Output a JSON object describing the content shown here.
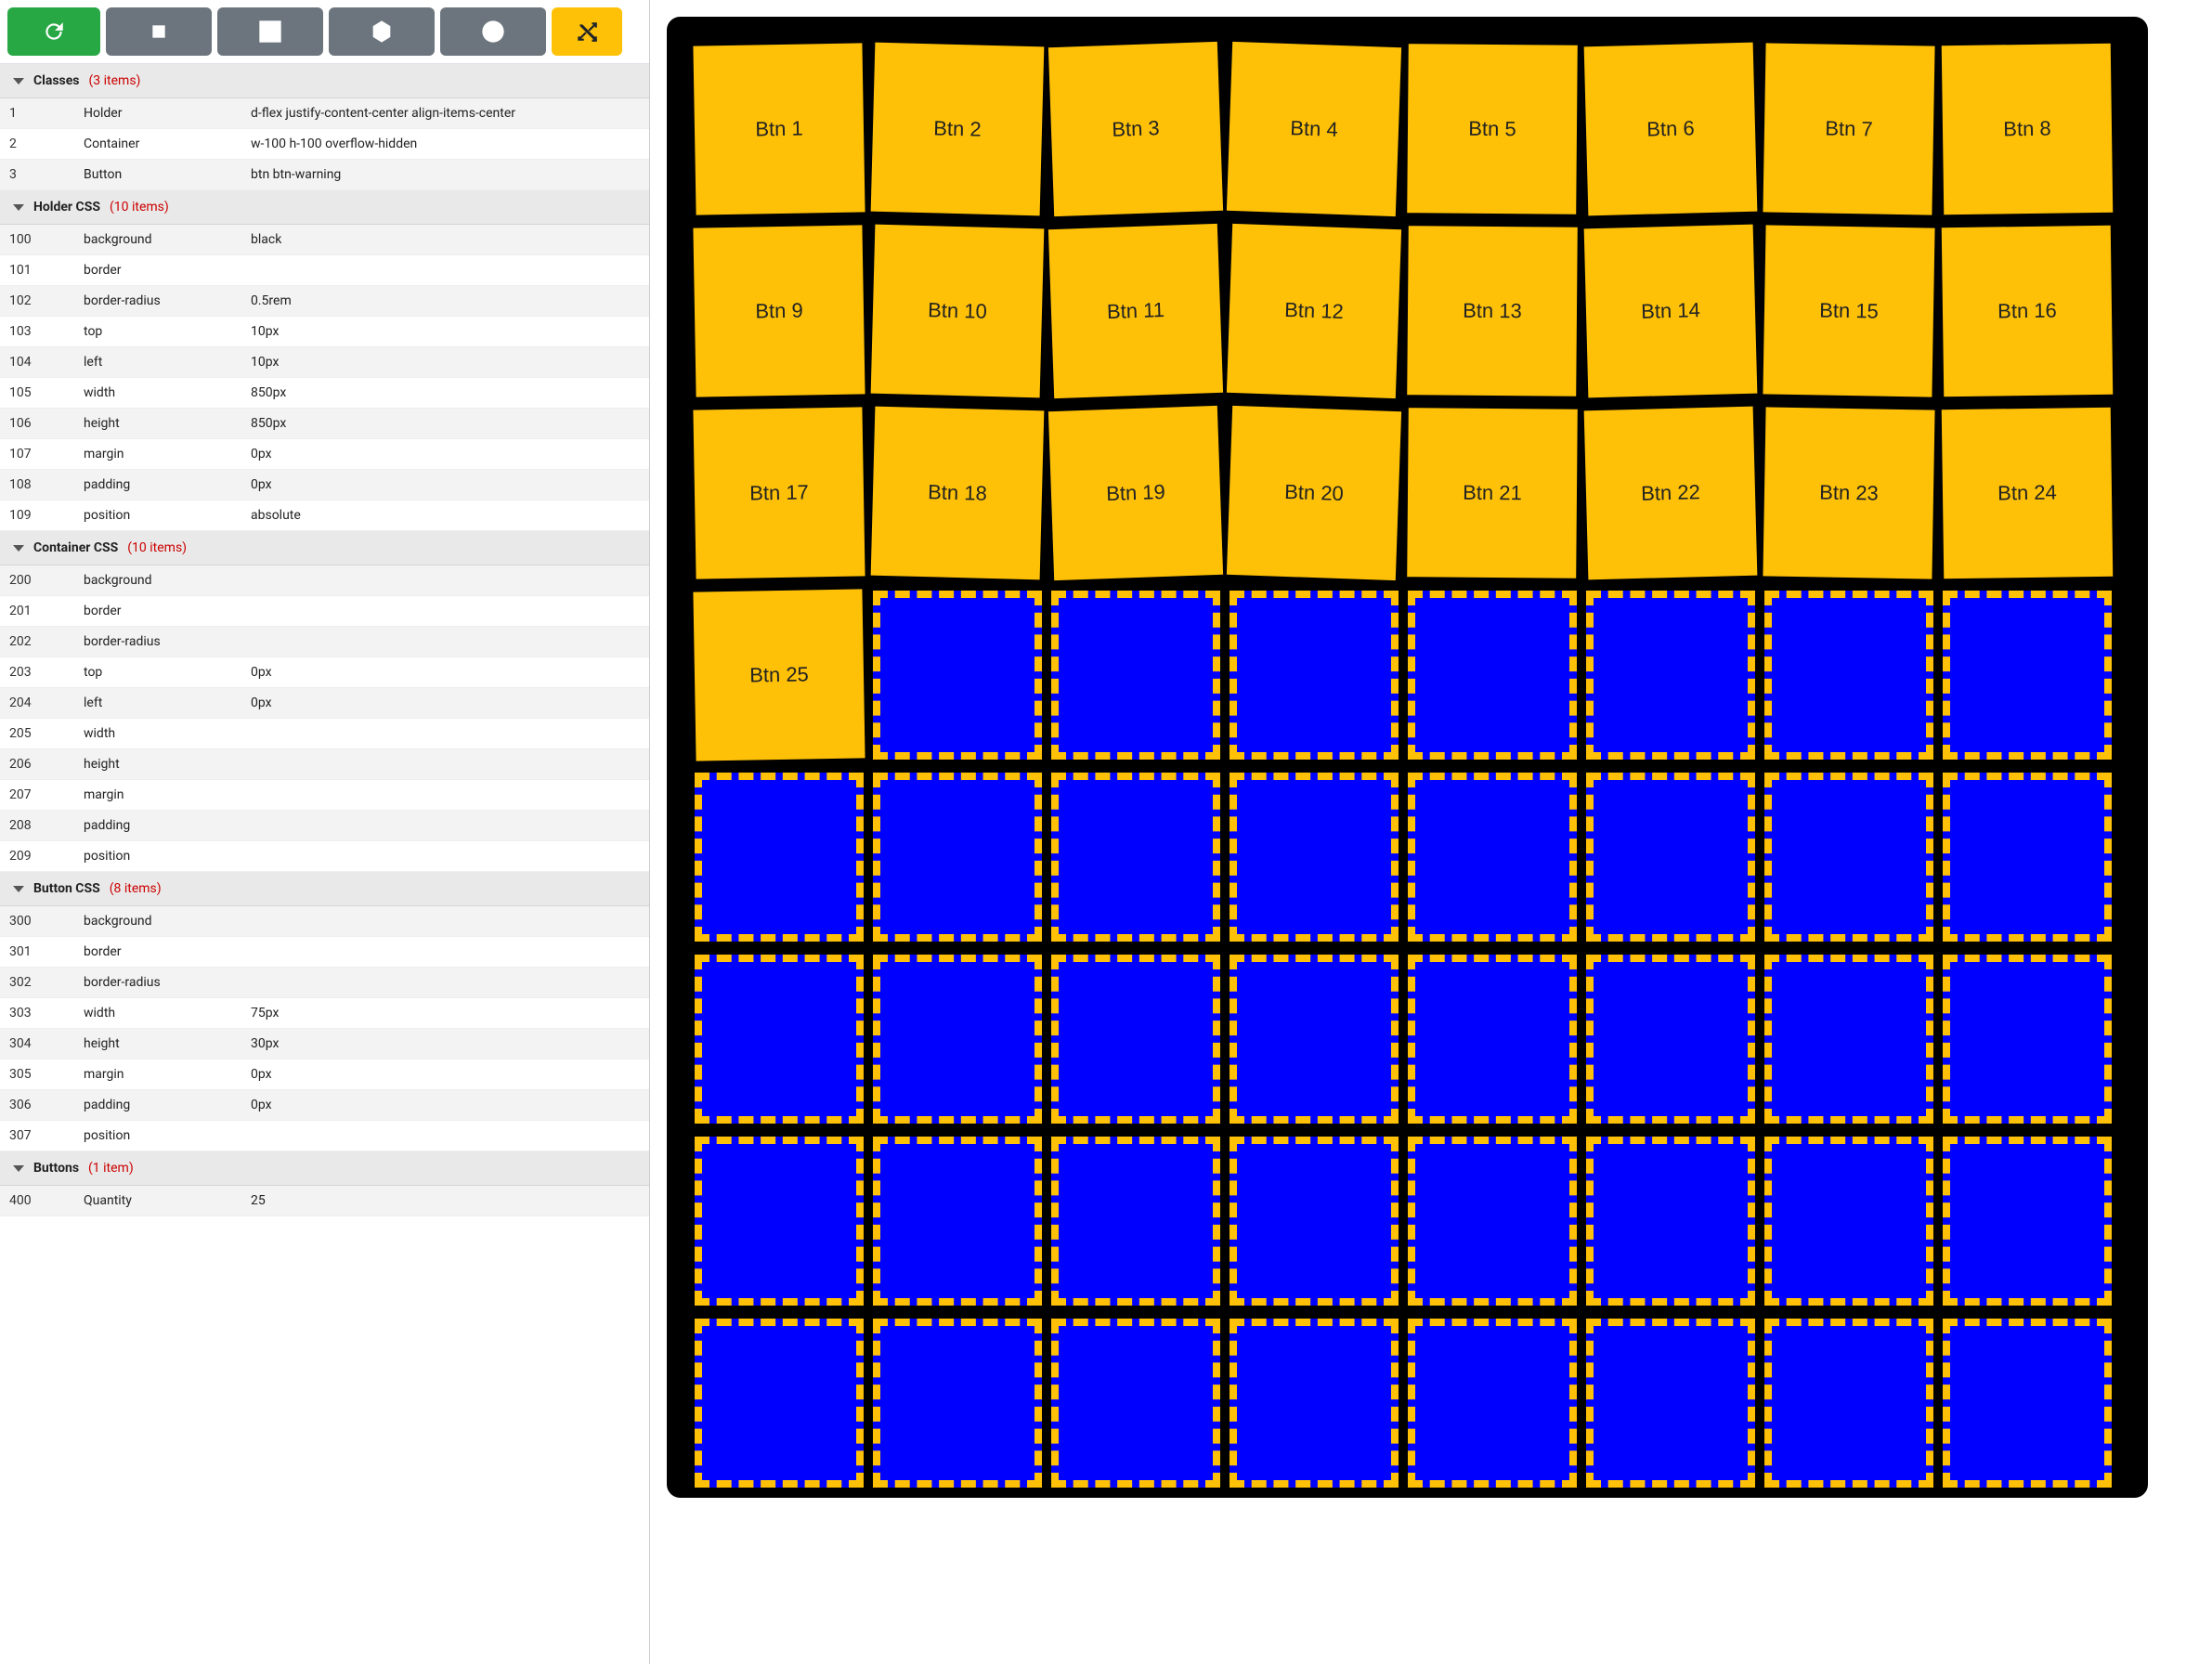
{
  "toolbar": {
    "buttons": [
      "refresh",
      "square-small",
      "square-large",
      "hexagon",
      "circle",
      "shuffle"
    ]
  },
  "sections": {
    "classes": {
      "title": "Classes",
      "count": "(3 items)",
      "rows": [
        {
          "id": "1",
          "key": "Holder",
          "value": "d-flex justify-content-center align-items-center"
        },
        {
          "id": "2",
          "key": "Container",
          "value": "w-100 h-100 overflow-hidden"
        },
        {
          "id": "3",
          "key": "Button",
          "value": "btn btn-warning"
        }
      ]
    },
    "holderCss": {
      "title": "Holder CSS",
      "count": "(10 items)",
      "rows": [
        {
          "id": "100",
          "key": "background",
          "value": "black"
        },
        {
          "id": "101",
          "key": "border",
          "value": ""
        },
        {
          "id": "102",
          "key": "border-radius",
          "value": "0.5rem"
        },
        {
          "id": "103",
          "key": "top",
          "value": "10px"
        },
        {
          "id": "104",
          "key": "left",
          "value": "10px"
        },
        {
          "id": "105",
          "key": "width",
          "value": "850px"
        },
        {
          "id": "106",
          "key": "height",
          "value": "850px"
        },
        {
          "id": "107",
          "key": "margin",
          "value": "0px"
        },
        {
          "id": "108",
          "key": "padding",
          "value": "0px"
        },
        {
          "id": "109",
          "key": "position",
          "value": "absolute"
        }
      ]
    },
    "containerCss": {
      "title": "Container CSS",
      "count": "(10 items)",
      "rows": [
        {
          "id": "200",
          "key": "background",
          "value": ""
        },
        {
          "id": "201",
          "key": "border",
          "value": ""
        },
        {
          "id": "202",
          "key": "border-radius",
          "value": ""
        },
        {
          "id": "203",
          "key": "top",
          "value": "0px"
        },
        {
          "id": "204",
          "key": "left",
          "value": "0px"
        },
        {
          "id": "205",
          "key": "width",
          "value": ""
        },
        {
          "id": "206",
          "key": "height",
          "value": ""
        },
        {
          "id": "207",
          "key": "margin",
          "value": ""
        },
        {
          "id": "208",
          "key": "padding",
          "value": ""
        },
        {
          "id": "209",
          "key": "position",
          "value": ""
        }
      ]
    },
    "buttonCss": {
      "title": "Button CSS",
      "count": "(8 items)",
      "rows": [
        {
          "id": "300",
          "key": "background",
          "value": ""
        },
        {
          "id": "301",
          "key": "border",
          "value": ""
        },
        {
          "id": "302",
          "key": "border-radius",
          "value": ""
        },
        {
          "id": "303",
          "key": "width",
          "value": "75px"
        },
        {
          "id": "304",
          "key": "height",
          "value": "30px"
        },
        {
          "id": "305",
          "key": "margin",
          "value": "0px"
        },
        {
          "id": "306",
          "key": "padding",
          "value": "0px"
        },
        {
          "id": "307",
          "key": "position",
          "value": ""
        }
      ]
    },
    "buttons": {
      "title": "Buttons",
      "count": "(1 item)",
      "rows": [
        {
          "id": "400",
          "key": "Quantity",
          "value": "25"
        }
      ]
    }
  },
  "preview": {
    "total_cells": 64,
    "labeled_buttons": [
      "Btn 1",
      "Btn 2",
      "Btn 3",
      "Btn 4",
      "Btn 5",
      "Btn 6",
      "Btn 7",
      "Btn 8",
      "Btn 9",
      "Btn 10",
      "Btn 11",
      "Btn 12",
      "Btn 13",
      "Btn 14",
      "Btn 15",
      "Btn 16",
      "Btn 17",
      "Btn 18",
      "Btn 19",
      "Btn 20",
      "Btn 21",
      "Btn 22",
      "Btn 23",
      "Btn 24",
      "Btn 25"
    ]
  }
}
